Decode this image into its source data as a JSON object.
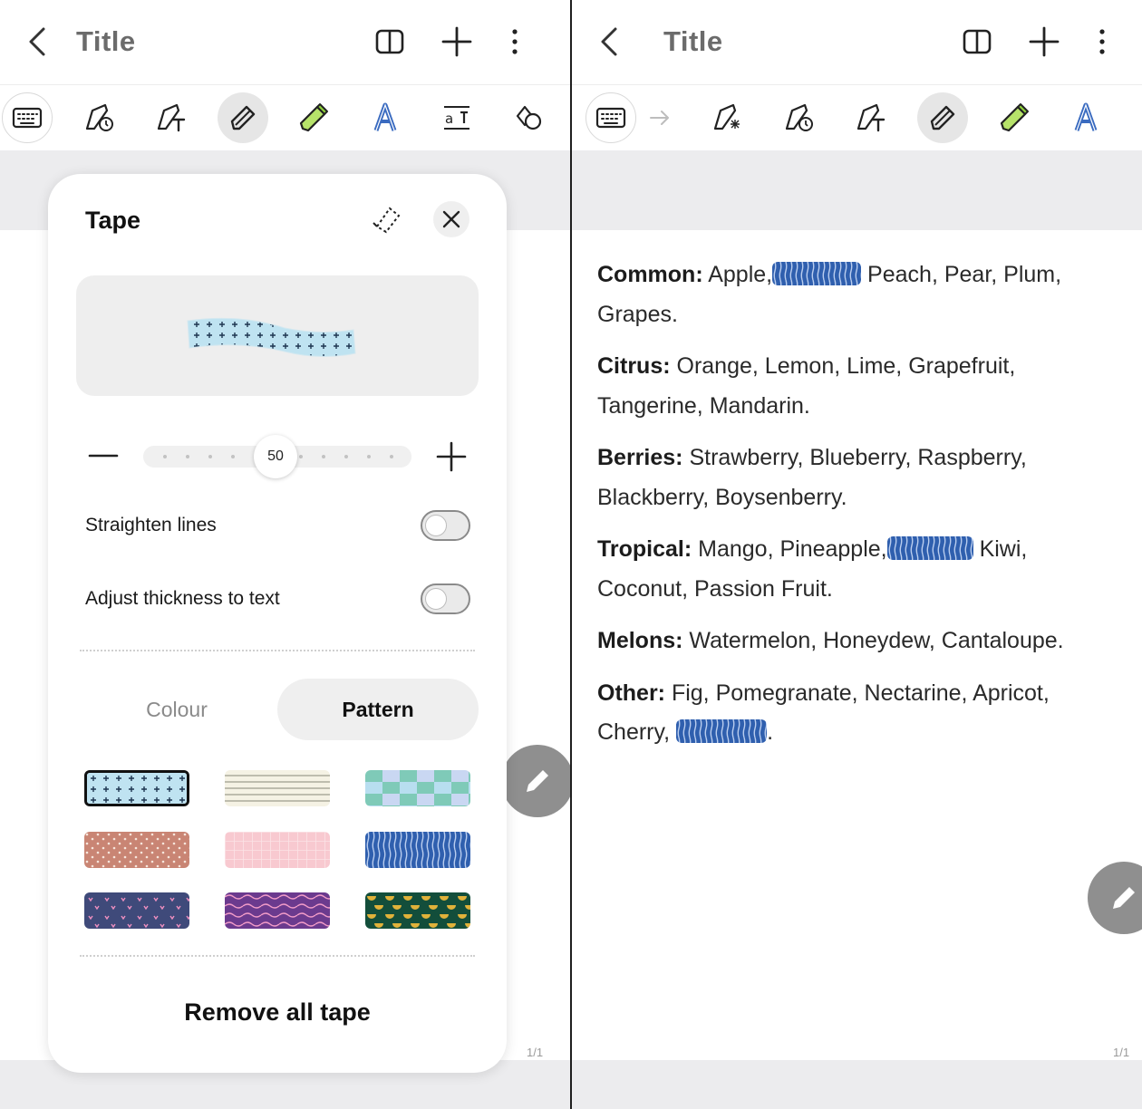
{
  "left": {
    "title": "Title",
    "panel": {
      "title": "Tape",
      "slider_value": "50",
      "slider_fraction": 0.5,
      "options": [
        {
          "label": "Straighten lines",
          "on": false
        },
        {
          "label": "Adjust thickness to text",
          "on": false
        }
      ],
      "tabs": {
        "colour": "Colour",
        "pattern": "Pattern",
        "selected": "Pattern"
      },
      "patterns": [
        "blue-cross",
        "lined-paper",
        "teal-check",
        "brown-dots",
        "pink-grid",
        "blue-stripes",
        "navy-hearts",
        "purple-waves",
        "green-scallops"
      ],
      "selected_pattern": "blue-cross",
      "remove_all": "Remove all tape"
    },
    "page_number": "1/1"
  },
  "right": {
    "title": "Title",
    "notes": [
      {
        "category": "Common:",
        "text_before": " Apple,",
        "tape": true,
        "text_after": " Peach, Pear, Plum, Grapes."
      },
      {
        "category": "Citrus:",
        "text_before": " Orange, Lemon, Lime, Grapefruit, Tangerine, Mandarin.",
        "tape": false,
        "text_after": ""
      },
      {
        "category": "Berries:",
        "text_before": " Strawberry, Blueberry, Raspberry, Blackberry, Boysenberry.",
        "tape": false,
        "text_after": ""
      },
      {
        "category": "Tropical:",
        "text_before": " Mango, Pineapple,",
        "tape": true,
        "text_after": " Kiwi, Coconut, Passion Fruit."
      },
      {
        "category": "Melons:",
        "text_before": " Watermelon, Honeydew, Cantaloupe.",
        "tape": false,
        "text_after": ""
      },
      {
        "category": "Other:",
        "text_before": " Fig, Pomegranate, Nectarine, Apricot, Cherry,",
        "tape": true,
        "text_after": "."
      }
    ],
    "page_number": "1/1"
  },
  "icons": {
    "back": "chevron-left-icon",
    "book": "book-icon",
    "add": "plus-icon",
    "more": "more-vertical-icon",
    "keyboard": "keyboard-icon",
    "redo": "arrow-right-icon",
    "edit": "pencil-icon"
  },
  "colors": {
    "accent_blue": "#3a6bc0",
    "tape_blue": "#2f5fae",
    "fab": "#8f8f8f",
    "band": "#ececee"
  }
}
